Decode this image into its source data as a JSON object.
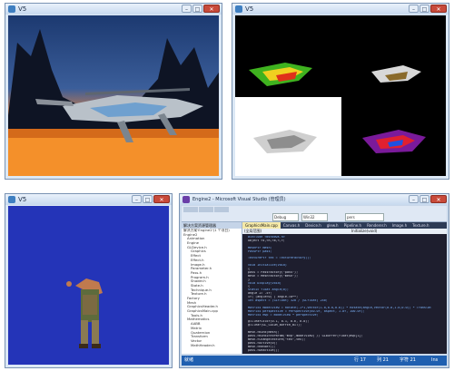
{
  "windows": {
    "w1": {
      "title": "V5"
    },
    "w2": {
      "title": "V5"
    },
    "w3": {
      "title": "V5"
    },
    "ide": {
      "title": "Engine2 - Microsoft Visual Studio (管理员)",
      "toolbar": {
        "config": "Debug",
        "platform": "Win32",
        "find": "pers"
      },
      "tabs": [
        "GraphicsMain.cpp",
        "Canvas.h",
        "Device.h",
        "glew.h",
        "Pipeline.h",
        "Renderer.h",
        "Image.h",
        "Texture.h"
      ],
      "scope": "(全局范围)",
      "member": "Initialize(void)",
      "explorer_title": "解决方案资源管理器",
      "tree": [
        "解决方案'Engine2'(1 个项目)",
        "Engine2",
        "Animation",
        "Engine",
        "GLDevice.h",
        "Graphics",
        "Effect",
        "Effect.h",
        "Image.h",
        "Parameter.h",
        "Pass.h",
        "Program.h",
        "Shader.h",
        "State.h",
        "Technique.h",
        "Texture.h",
        "Factory",
        "Mesh",
        "GraphicsHeader.h",
        "GraphicsMain.cpp",
        "Tools.h",
        "Mathematics",
        "AABB",
        "Matrix",
        "Quaternion",
        "Transform",
        "Vector",
        "MathHeader.h"
      ],
      "code": [
        "#include <Windows.h>",
        "Object <s,<h,<b,<,>;",
        "",
        "MeshPtr mesh;",
        "PassPtr pass;",
        "",
        "TexturePtr tex = TextureFactory();",
        "",
        "void Initialize(void)",
        "{",
        "    pass = PassFactory(\"pass\");",
        "    mesh = MeshFactory(\"mesh\");",
        "}",
        "void Display(void)",
        "{",
        "    static float angle(0);",
        "    angle += .5f;",
        "    if( (angle>0) ) angle-=0**;",
        "    int aspect = (GLfloat) 320 / (GLfloat) 240;",
        "",
        "    Matrix4 modelview = Rotate(-1*1,Vector(1.0,0.0,0.0)) * Rotate(angle,Vector(0.0,1.0,0.0)) * Translat",
        "    Matrix4 perspective = Perspective(60.0f, aspect, 1.0f, 100.0f);",
        "    Matrix4 mvp = modelview * perspective;",
        "",
        "    glClearColor(0.1, 0.1, 0.6, 0.0);",
        "    glClear(GL_COLOR_BUFFER_BIT);",
        "",
        "    mesh->Bind(mesh);",
        "    pass->BindInfoParam(\"mvp\",modelview) // GLbuffer(float)mvp[1];",
        "    mesh->ChangeTexture(\"tex\",tex);",
        "    pass->Active(0);",
        "    mesh->Render();",
        "    pass->Deactive();"
      ],
      "status": {
        "left": "就绪",
        "ln": "行 17",
        "col": "列 21",
        "ch": "字符 21",
        "ins": "Ins"
      }
    }
  },
  "colors": {
    "sky": "#2a4a8a",
    "ground": "#f08020",
    "blue_bg": "#2434b8",
    "code_bg": "#1e1e2e"
  }
}
